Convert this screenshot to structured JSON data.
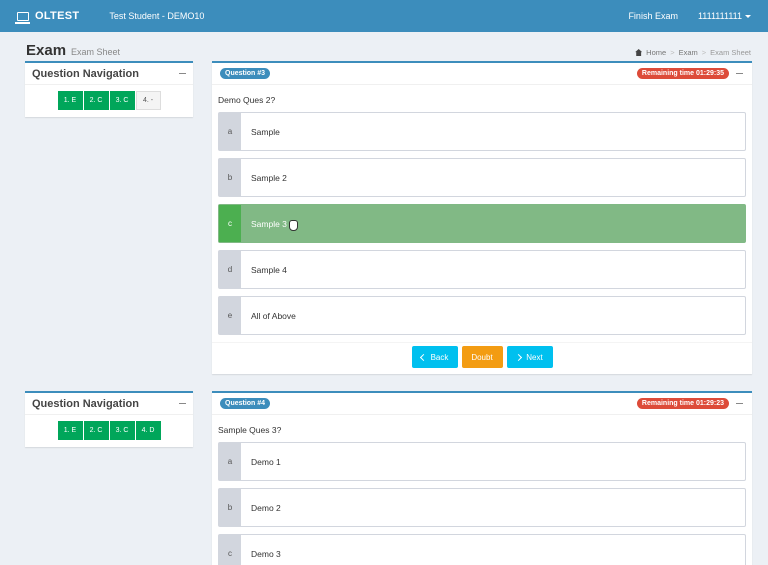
{
  "app": {
    "brand": "OLTEST",
    "student": "Test Student - DEMO10"
  },
  "header": {
    "finish_label": "Finish Exam",
    "user_label": "1111111111"
  },
  "page": {
    "title": "Exam",
    "subtitle": "Exam Sheet"
  },
  "breadcrumb": {
    "home": "Home",
    "exam": "Exam",
    "current": "Exam Sheet"
  },
  "nav1": {
    "title": "Question Navigation",
    "items": [
      {
        "label": "1. E",
        "answered": true
      },
      {
        "label": "2. C",
        "answered": true
      },
      {
        "label": "3. C",
        "answered": true
      },
      {
        "label": "4. -",
        "answered": false
      }
    ]
  },
  "q1": {
    "badge": "Question #3",
    "time": "Remaining time 01:29:35",
    "text": "Demo Ques 2?",
    "options": [
      {
        "letter": "a",
        "text": "Sample"
      },
      {
        "letter": "b",
        "text": "Sample 2"
      },
      {
        "letter": "c",
        "text": "Sample 3",
        "selected": true
      },
      {
        "letter": "d",
        "text": "Sample 4"
      },
      {
        "letter": "e",
        "text": "All of Above"
      }
    ],
    "back_label": "Back",
    "doubt_label": "Doubt",
    "next_label": "Next"
  },
  "nav2": {
    "title": "Question Navigation",
    "items": [
      {
        "label": "1. E",
        "answered": true
      },
      {
        "label": "2. C",
        "answered": true
      },
      {
        "label": "3. C",
        "answered": true
      },
      {
        "label": "4. D",
        "answered": true
      }
    ]
  },
  "q2": {
    "badge": "Question #4",
    "time": "Remaining time 01:29:23",
    "text": "Sample Ques 3?",
    "options": [
      {
        "letter": "a",
        "text": "Demo 1"
      },
      {
        "letter": "b",
        "text": "Demo 2"
      },
      {
        "letter": "c",
        "text": "Demo 3"
      }
    ]
  },
  "colors": {
    "primary": "#3c8dbc",
    "success": "#00a65a",
    "selected": "#81b985",
    "danger": "#dd4b39",
    "info": "#00c0ef",
    "warning": "#f39c12"
  },
  "icons": {
    "brand": "laptop-icon",
    "home": "home-icon",
    "back": "chevron-left-icon",
    "next": "chevron-right-icon",
    "pointer": "hand-pointer-icon"
  }
}
